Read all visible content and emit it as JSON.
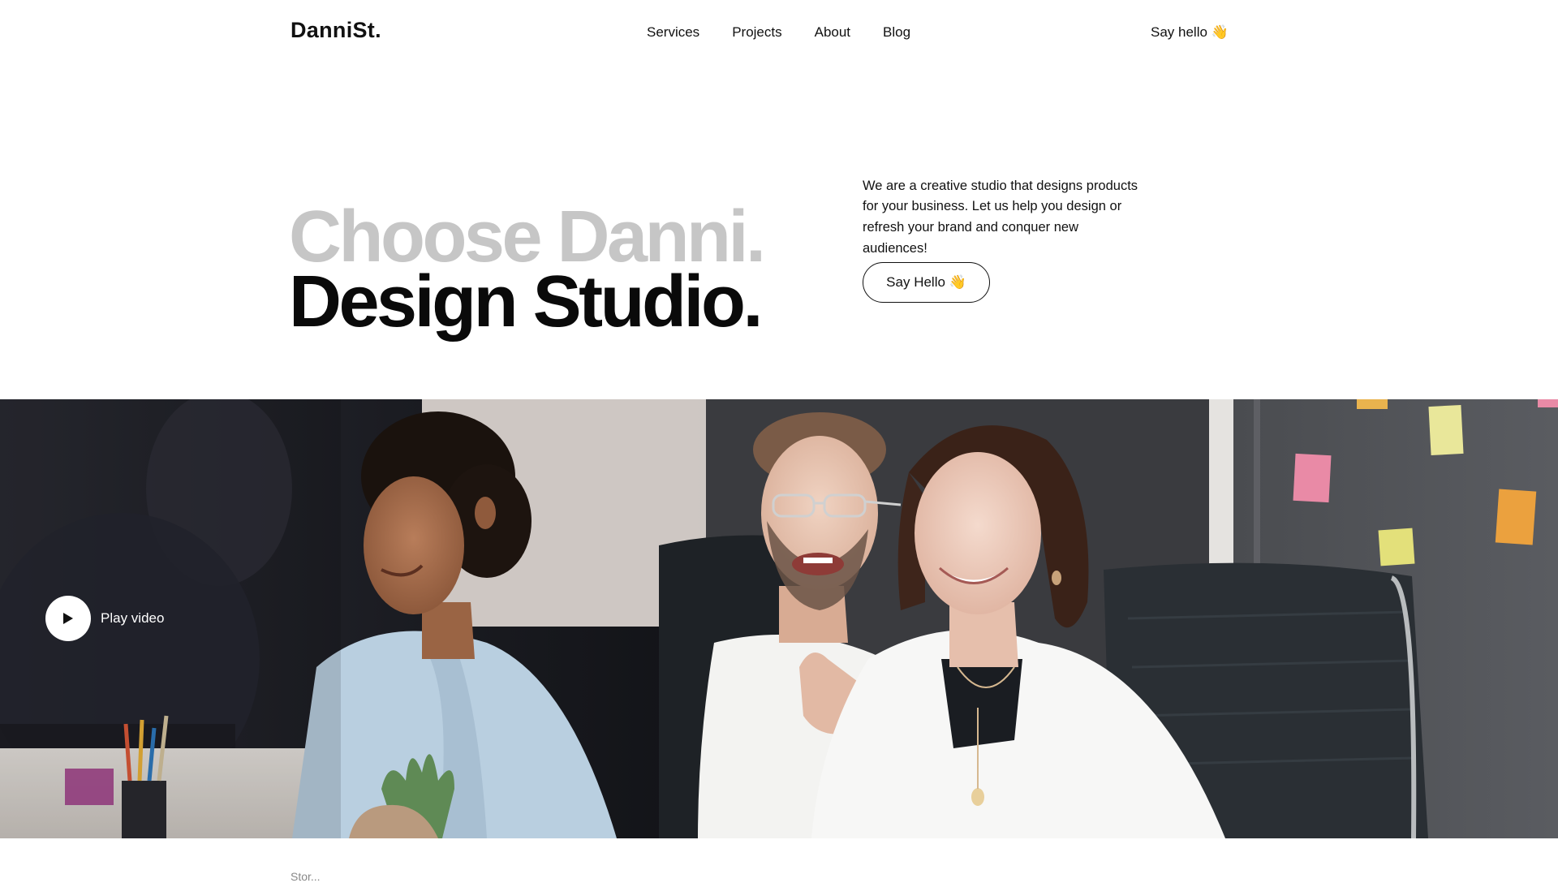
{
  "header": {
    "logo": "DanniSt.",
    "nav": [
      "Services",
      "Projects",
      "About",
      "Blog"
    ],
    "cta": "Say hello 👋"
  },
  "hero": {
    "title_line_1": "Choose Danni.",
    "title_line_2": "Design Studio.",
    "description": "We are a creative studio that designs products for your business. Let us help you design or refresh your brand and conquer new audiences!",
    "button_label": "Say Hello 👋"
  },
  "video": {
    "play_label": "Play video",
    "play_icon": "play-icon"
  },
  "below": {
    "partial_text": "Stor..."
  },
  "colors": {
    "title_muted": "#c6c6c6",
    "title_dark": "#0a0a0a",
    "background": "#ffffff"
  }
}
